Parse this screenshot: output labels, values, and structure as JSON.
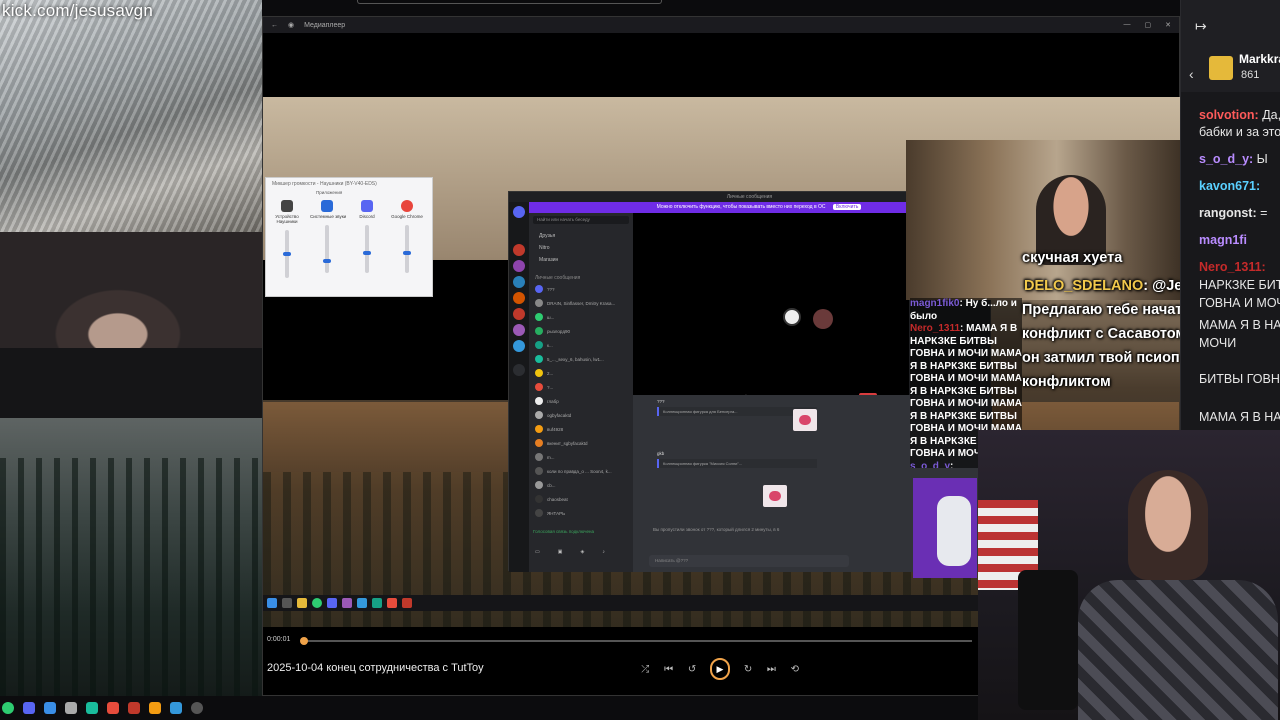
{
  "stream": {
    "url_overlay": "kick.com/jesusavgn"
  },
  "player": {
    "window_title": "Медиаплеер",
    "time_current": "0:00:01",
    "video_title": "2025-10-04 конец сотрудничества с TutToy",
    "progress_fraction": 0.003,
    "accent_color": "#f0a34a"
  },
  "mixer": {
    "title": "Микшер громкости - Наушники (BY-V40-EDS)",
    "columns": [
      {
        "label": "Устройство",
        "sub": "Наушники",
        "color": "#444",
        "level": 0.55
      },
      {
        "label": "Системные звуки",
        "sub": "",
        "color": "#2a6ad8",
        "level": 0.75
      },
      {
        "label": "Discord",
        "sub": "",
        "color": "#5865f2",
        "level": 0.6
      },
      {
        "label": "Google Chrome",
        "sub": "",
        "color": "#e8453c",
        "level": 0.6
      }
    ],
    "apps_header": "Приложения"
  },
  "discord": {
    "window_title": "Личные сообщения",
    "banner": "Можно отключить функцию, чтобы показывать вместо них переход в ОС",
    "banner_button": "Включить",
    "search_placeholder": "Найти или начать беседу",
    "nav": [
      "Друзья",
      "Nitro",
      "Магазин"
    ],
    "dm_header": "Личные сообщения",
    "dms": [
      "???",
      "DRAIN, Sinflasser, Dmitry Krasa...",
      "ш...",
      "рызлорд90",
      "к...",
      "5_..._sexy_6, bahusin, lw1...",
      "2...",
      "?...",
      "глабр",
      "ogbyfacaktd",
      "вuf4928",
      "вкенит_sgbyfacaktd",
      "m...",
      "коли по правда_о ... Soon4, k...",
      "сb...",
      "chaosbeat",
      "ЯНТАРЬ"
    ],
    "voice_status": "Голосовая связь подключена",
    "chat_messages": [
      {
        "author": "???",
        "text": "Коллекционная фигурка для Бенсерга..."
      },
      {
        "author": "gkb",
        "text": "Коллекционная фигурка \"Миссия Солни\"..."
      }
    ],
    "chat_system": "Вы пропустили звонок от ???, который длился 2 минуты, в 6",
    "chat_input": "Написать @???"
  },
  "overlay_chat": [
    {
      "user": "magn1fik0",
      "text": ": Ну б...ло и было",
      "cls": "m"
    },
    {
      "user": "Nero_1311",
      "text": ": МАМА Я В НАРКЗКЕ БИТВЫ ГОВНА И МОЧИ МАМА Я В НАРКЗКЕ БИТВЫ ГОВНА И МОЧИ МАМА Я В НАРКЗКЕ БИТВЫ ГОВНА И МОЧИ МАМА Я В НАРКЗКЕ БИТВЫ ГОВНА И МОЧИ МАМА Я В НАРКЗКЕ БИТВЫ ГОВНА И МОЧИ",
      "cls": "n"
    },
    {
      "user": "s_o_d_y",
      "text": ":",
      "cls": "m"
    }
  ],
  "tts": {
    "line1": "скучная хуета",
    "sender": "DELO_SDELANO",
    "target": ": @JesusAVGN",
    "body": [
      "Предлагаю тебе начать",
      "конфликт с Сасавотом за то, что",
      "он затмил твой псиоп своим",
      "конфликтом"
    ]
  },
  "right_chat": {
    "header_user": "Markkra",
    "header_count": "861",
    "messages": [
      {
        "user": "solvotion:",
        "text": " Да,",
        "color": "#ff5a5a"
      },
      {
        "user": "",
        "text": "бабки и за это",
        "color": "#e6e6e6"
      },
      {
        "user": "s_o_d_y:",
        "text": " Ы",
        "color": "#b98cff"
      },
      {
        "user": "kavon671:",
        "text": " ",
        "color": "#5ad0ff"
      },
      {
        "user": "rangonst:",
        "text": " =",
        "color": "#e6e6e6"
      },
      {
        "user": "magn1fi",
        "text": "",
        "color": "#b98cff"
      },
      {
        "user": "Nero_1311:",
        "text": "",
        "color": "#c52a2a"
      },
      {
        "user": "",
        "text": "НАРКЗКЕ БИТВ",
        "color": "#e6e6e6"
      },
      {
        "user": "",
        "text": "ГОВНА И МОЧИ",
        "color": "#e6e6e6"
      },
      {
        "user": "",
        "text": "МАМА Я В НА",
        "color": "#e6e6e6"
      },
      {
        "user": "",
        "text": "МОЧИ",
        "color": "#e6e6e6"
      },
      {
        "user": "",
        "text": "БИТВЫ ГОВНА",
        "color": "#e6e6e6"
      },
      {
        "user": "",
        "text": "МАМА Я В НА",
        "color": "#e6e6e6"
      }
    ]
  }
}
